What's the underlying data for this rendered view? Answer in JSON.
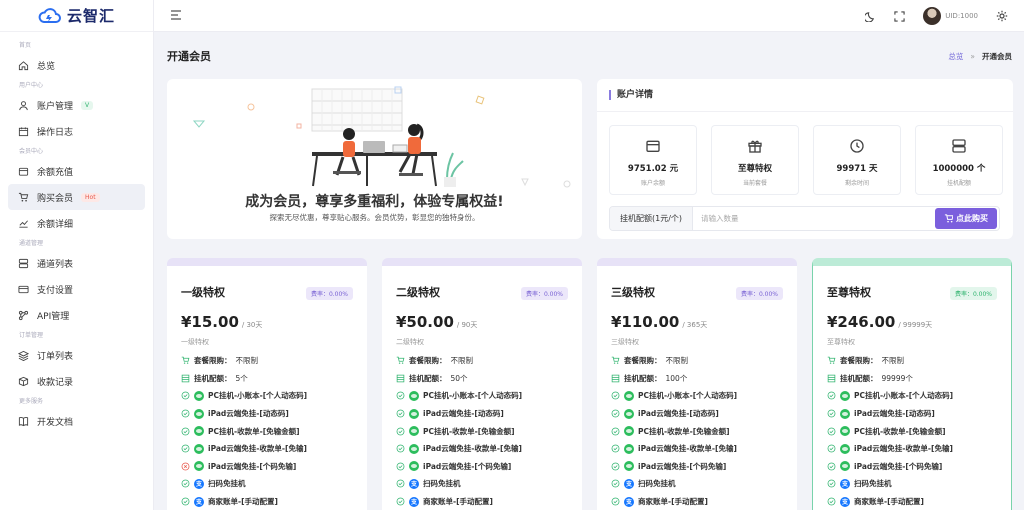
{
  "app": {
    "logo_text": "云智汇"
  },
  "sidebar": {
    "sections": [
      {
        "title": "首页",
        "items": [
          {
            "label": "总览",
            "icon": "home-icon"
          }
        ]
      },
      {
        "title": "用户中心",
        "items": [
          {
            "label": "账户管理",
            "icon": "user-icon",
            "badge": "V"
          },
          {
            "label": "操作日志",
            "icon": "calendar-icon"
          }
        ]
      },
      {
        "title": "会员中心",
        "items": [
          {
            "label": "余额充值",
            "icon": "wallet-icon"
          },
          {
            "label": "购买会员",
            "icon": "cart-icon",
            "badge": "Hot",
            "active": true
          },
          {
            "label": "余额详细",
            "icon": "chart-icon"
          }
        ]
      },
      {
        "title": "通道管理",
        "items": [
          {
            "label": "通道列表",
            "icon": "server-icon"
          },
          {
            "label": "支付设置",
            "icon": "card-icon"
          },
          {
            "label": "API管理",
            "icon": "api-icon"
          }
        ]
      },
      {
        "title": "订单管理",
        "items": [
          {
            "label": "订单列表",
            "icon": "layers-icon"
          },
          {
            "label": "收款记录",
            "icon": "box-icon"
          }
        ]
      },
      {
        "title": "更多服务",
        "items": [
          {
            "label": "开发文档",
            "icon": "book-icon"
          }
        ]
      }
    ]
  },
  "header": {
    "uid": "UID:1000"
  },
  "page": {
    "title": "开通会员",
    "breadcrumb_home": "总览",
    "breadcrumb_sep": "»",
    "breadcrumb_current": "开通会员"
  },
  "hero": {
    "headline": "成为会员，尊享多重福利，体验专属权益!",
    "subline": "探索无尽优惠，尊享贴心服务。会员优势，彰显您的独特身份。"
  },
  "account": {
    "title": "账户详情",
    "stats": [
      {
        "value": "9751.02 元",
        "label": "账户余额",
        "icon": "wallet-icon"
      },
      {
        "value": "至尊特权",
        "label": "当前套餐",
        "icon": "gift-icon"
      },
      {
        "value": "99971 天",
        "label": "剩余时间",
        "icon": "clock-icon"
      },
      {
        "value": "1000000 个",
        "label": "挂机配额",
        "icon": "server-icon"
      }
    ],
    "quota_label": "挂机配额(1元/个)",
    "quota_placeholder": "请输入数量",
    "buy_button": "点此购买"
  },
  "plans": [
    {
      "name": "一级特权",
      "rate": "费率：0.00%",
      "price": "¥15.00",
      "period": "/ 30天",
      "sub": "一级特权",
      "limit_label": "套餐限购：",
      "limit_value": "不限制",
      "quota_label": "挂机配额：",
      "quota_value": "5个",
      "features": [
        {
          "ok": true,
          "type": "wx",
          "text": "PC挂机-小账本-[个人动态码]"
        },
        {
          "ok": true,
          "type": "wx",
          "text": "iPad云端免挂-[动态码]"
        },
        {
          "ok": true,
          "type": "wx",
          "text": "PC挂机-收款单-[免输金额]"
        },
        {
          "ok": true,
          "type": "wx",
          "text": "iPad云端免挂-收款单-[免输]"
        },
        {
          "ok": false,
          "type": "wx",
          "text": "iPad云端免挂-[个码免输]"
        },
        {
          "ok": true,
          "type": "zfb",
          "text": "扫码免挂机"
        },
        {
          "ok": true,
          "type": "zfb",
          "text": "商家账单-[手动配置]"
        }
      ]
    },
    {
      "name": "二级特权",
      "rate": "费率：0.00%",
      "price": "¥50.00",
      "period": "/ 90天",
      "sub": "二级特权",
      "limit_label": "套餐限购：",
      "limit_value": "不限制",
      "quota_label": "挂机配额：",
      "quota_value": "50个",
      "features": [
        {
          "ok": true,
          "type": "wx",
          "text": "PC挂机-小账本-[个人动态码]"
        },
        {
          "ok": true,
          "type": "wx",
          "text": "iPad云端免挂-[动态码]"
        },
        {
          "ok": true,
          "type": "wx",
          "text": "PC挂机-收款单-[免输金额]"
        },
        {
          "ok": true,
          "type": "wx",
          "text": "iPad云端免挂-收款单-[免输]"
        },
        {
          "ok": true,
          "type": "wx",
          "text": "iPad云端免挂-[个码免输]"
        },
        {
          "ok": true,
          "type": "zfb",
          "text": "扫码免挂机"
        },
        {
          "ok": true,
          "type": "zfb",
          "text": "商家账单-[手动配置]"
        }
      ]
    },
    {
      "name": "三级特权",
      "rate": "费率：0.00%",
      "price": "¥110.00",
      "period": "/ 365天",
      "sub": "三级特权",
      "limit_label": "套餐限购：",
      "limit_value": "不限制",
      "quota_label": "挂机配额：",
      "quota_value": "100个",
      "features": [
        {
          "ok": true,
          "type": "wx",
          "text": "PC挂机-小账本-[个人动态码]"
        },
        {
          "ok": true,
          "type": "wx",
          "text": "iPad云端免挂-[动态码]"
        },
        {
          "ok": true,
          "type": "wx",
          "text": "PC挂机-收款单-[免输金额]"
        },
        {
          "ok": true,
          "type": "wx",
          "text": "iPad云端免挂-收款单-[免输]"
        },
        {
          "ok": true,
          "type": "wx",
          "text": "iPad云端免挂-[个码免输]"
        },
        {
          "ok": true,
          "type": "zfb",
          "text": "扫码免挂机"
        },
        {
          "ok": true,
          "type": "zfb",
          "text": "商家账单-[手动配置]"
        }
      ]
    },
    {
      "name": "至尊特权",
      "rate": "费率：0.00%",
      "price": "¥246.00",
      "period": "/ 99999天",
      "sub": "至尊特权",
      "limit_label": "套餐限购：",
      "limit_value": "不限制",
      "quota_label": "挂机配额：",
      "quota_value": "99999个",
      "features": [
        {
          "ok": true,
          "type": "wx",
          "text": "PC挂机-小账本-[个人动态码]"
        },
        {
          "ok": true,
          "type": "wx",
          "text": "iPad云端免挂-[动态码]"
        },
        {
          "ok": true,
          "type": "wx",
          "text": "PC挂机-收款单-[免输金额]"
        },
        {
          "ok": true,
          "type": "wx",
          "text": "iPad云端免挂-收款单-[免输]"
        },
        {
          "ok": true,
          "type": "wx",
          "text": "iPad云端免挂-[个码免输]"
        },
        {
          "ok": true,
          "type": "zfb",
          "text": "扫码免挂机"
        },
        {
          "ok": true,
          "type": "zfb",
          "text": "商家账单-[手动配置]"
        }
      ]
    }
  ],
  "colors": {
    "accent": "#7b5fdd",
    "ok": "#2fb36e",
    "no": "#e8574a",
    "wechat": "#2dbd5d",
    "alipay": "#1677ff"
  }
}
